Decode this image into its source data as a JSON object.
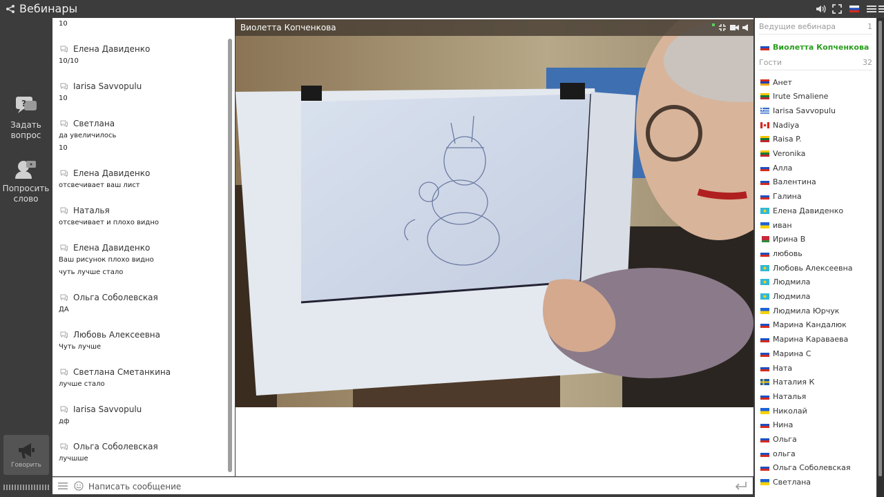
{
  "app": {
    "title": "Вебинары"
  },
  "rail": {
    "ask_label_1": "Задать",
    "ask_label_2": "вопрос",
    "word_label_1": "Попросить",
    "word_label_2": "слово",
    "speak_label": "Говорить"
  },
  "chat": {
    "messages": [
      {
        "author": "",
        "lines": [
          "10"
        ]
      },
      {
        "author": "Елена Давиденко",
        "lines": [
          "10/10"
        ]
      },
      {
        "author": "Iarisa Savvopulu",
        "lines": [
          "10"
        ]
      },
      {
        "author": "Светлана",
        "lines": [
          "да увеличилось",
          "10"
        ]
      },
      {
        "author": "Елена Давиденко",
        "lines": [
          "отсвечивает ваш лист"
        ]
      },
      {
        "author": "Наталья",
        "lines": [
          "отсвечивает и плохо видно"
        ]
      },
      {
        "author": "Елена Давиденко",
        "lines": [
          "Ваш рисунок плохо видно",
          "чуть лучше стало"
        ]
      },
      {
        "author": "Ольга Соболевская",
        "lines": [
          "ДА"
        ]
      },
      {
        "author": "Любовь Алексеевна",
        "lines": [
          "Чуть лучше"
        ]
      },
      {
        "author": "Светлана Сметанкина",
        "lines": [
          "лучше стало"
        ]
      },
      {
        "author": "Iarisa Savvopulu",
        "lines": [
          "дф"
        ]
      },
      {
        "author": "Ольга Соболевская",
        "lines": [
          "лучшше"
        ]
      }
    ]
  },
  "composer": {
    "placeholder": "Написать сообщение"
  },
  "video": {
    "speaker": "Виолетта Копченкова"
  },
  "people": {
    "hosts_label": "Ведущие вебинара",
    "hosts_count": "1",
    "host": {
      "name": "Виолетта Копченкова",
      "flag": "ru"
    },
    "guests_label": "Гости",
    "guests_count": "32",
    "guests": [
      {
        "name": "Анет",
        "flag": "am"
      },
      {
        "name": "Irute Smaliene",
        "flag": "lt"
      },
      {
        "name": "Iarisa Savvopulu",
        "flag": "gr"
      },
      {
        "name": "Nadiya",
        "flag": "ca"
      },
      {
        "name": "Raisa P.",
        "flag": "lt"
      },
      {
        "name": "Veronika",
        "flag": "lt"
      },
      {
        "name": "Алла",
        "flag": "ru"
      },
      {
        "name": "Валентина",
        "flag": "ru"
      },
      {
        "name": "Галина",
        "flag": "ru"
      },
      {
        "name": "Елена Давиденко",
        "flag": "kz"
      },
      {
        "name": "иван",
        "flag": "ua"
      },
      {
        "name": "Ирина В",
        "flag": "by"
      },
      {
        "name": "любовь",
        "flag": "ru"
      },
      {
        "name": "Любовь Алексеевна",
        "flag": "kz"
      },
      {
        "name": "Людмила",
        "flag": "kz"
      },
      {
        "name": "Людмила",
        "flag": "kz"
      },
      {
        "name": "Людмила Юрчук",
        "flag": "ua"
      },
      {
        "name": "Марина Кандалюк",
        "flag": "ru"
      },
      {
        "name": "Марина Караваева",
        "flag": "ru"
      },
      {
        "name": "Марина С",
        "flag": "ru"
      },
      {
        "name": "Ната",
        "flag": "ru"
      },
      {
        "name": "Наталия К",
        "flag": "se"
      },
      {
        "name": "Наталья",
        "flag": "ru"
      },
      {
        "name": "Николай",
        "flag": "ua"
      },
      {
        "name": "Нина",
        "flag": "ru"
      },
      {
        "name": "Ольга",
        "flag": "ru"
      },
      {
        "name": "ольга",
        "flag": "ru"
      },
      {
        "name": "Ольга Соболевская",
        "flag": "ru"
      },
      {
        "name": "Светлана",
        "flag": "ua"
      }
    ]
  }
}
